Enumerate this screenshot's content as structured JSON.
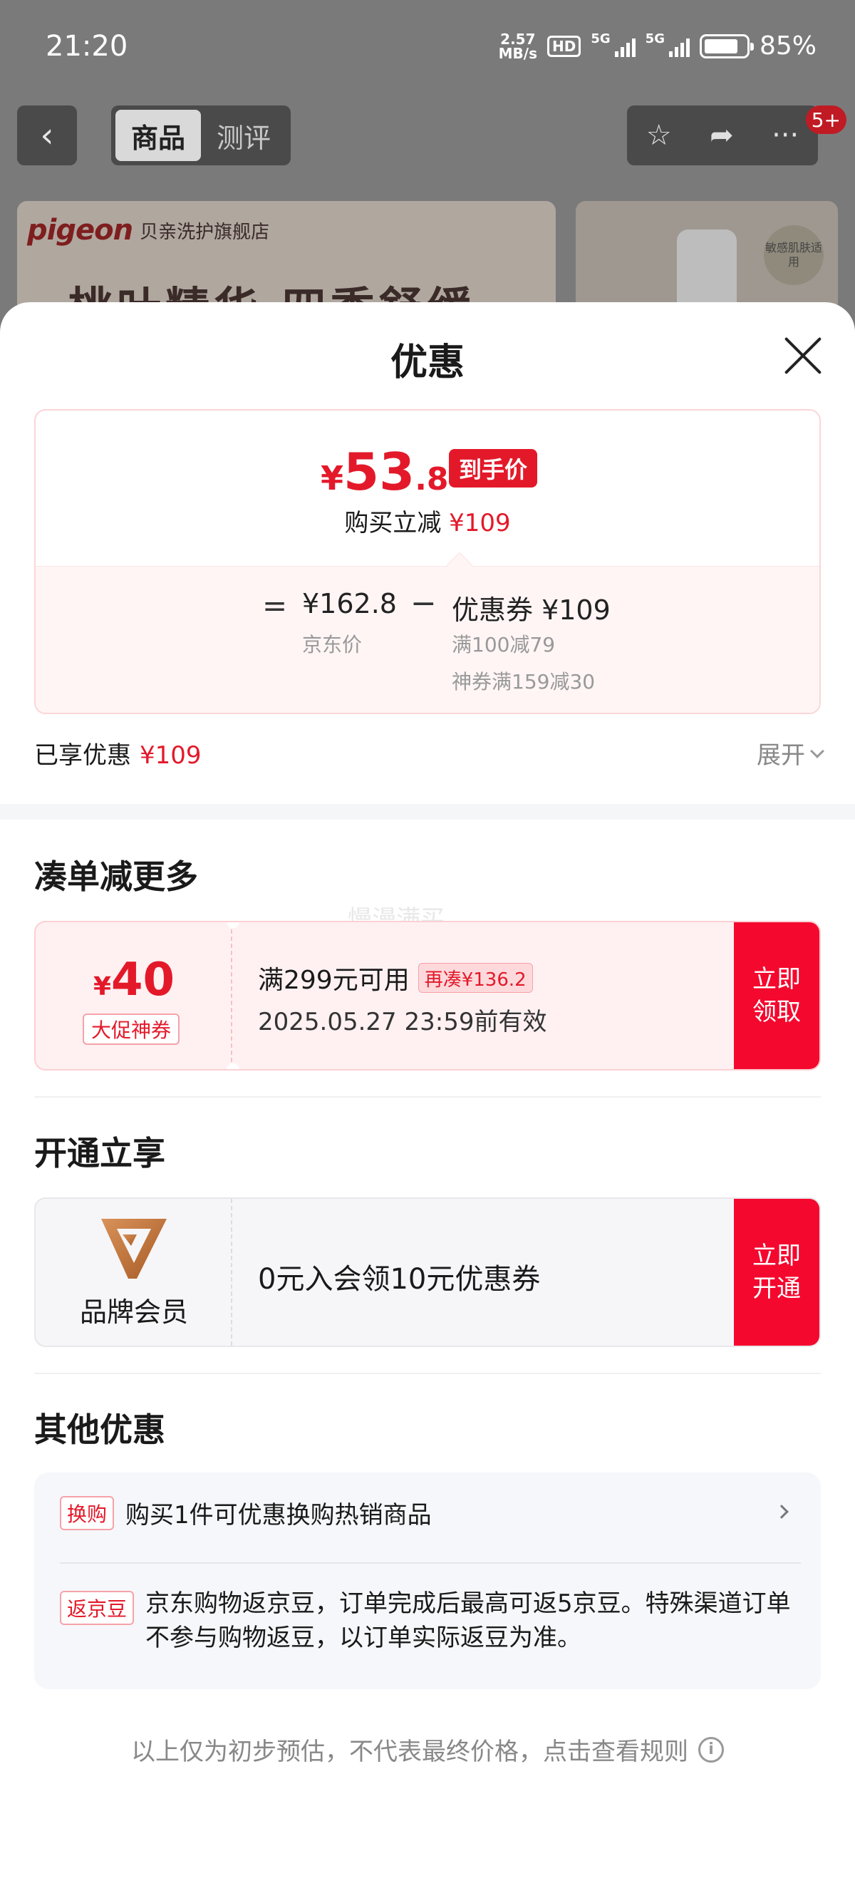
{
  "status_bar": {
    "time": "21:20",
    "net_speed_value": "2.57",
    "net_speed_unit": "MB/s",
    "hd_label": "HD",
    "sig1_label": "5G",
    "sig2_label": "5G",
    "battery": "85%"
  },
  "nav": {
    "tab_product": "商品",
    "tab_review": "测评",
    "badge_count": "5+"
  },
  "banner": {
    "logo": "pigeon",
    "store_name": "贝亲洗护旗舰店",
    "slogan": "桃叶精华 四季舒缓",
    "thumb_tag": "敏感肌肤适用"
  },
  "sheet": {
    "title": "优惠",
    "price": {
      "yen": "¥",
      "final_int": "53",
      "final_dec": ".8",
      "final_tag": "到手价",
      "instant_off_label": "购买立减",
      "instant_off_value": "¥109",
      "equals": "=",
      "jd_price": "¥162.8",
      "jd_label": "京东价",
      "minus": "−",
      "coupon_label": "优惠券 ¥109",
      "coupon_rule1": "满100减79",
      "coupon_rule2": "神券满159减30"
    },
    "enjoyed_label": "已享优惠",
    "enjoyed_value": "¥109",
    "expand_label": "展开",
    "section_more": "凑单减更多",
    "watermark": "慢漫满买",
    "coupon": {
      "yen": "¥",
      "amount": "40",
      "type": "大促神券",
      "condition": "满299元可用",
      "topup": "再凑¥136.2",
      "valid_until": "2025.05.27 23:59前有效",
      "cta": "立即领取"
    },
    "section_open": "开通立享",
    "membership": {
      "label": "品牌会员",
      "offer": "0元入会领10元优惠券",
      "cta": "立即开通"
    },
    "section_other": "其他优惠",
    "other": [
      {
        "tag": "换购",
        "text": "购买1件可优惠换购热销商品"
      },
      {
        "tag": "返京豆",
        "text": "京东购物返京豆，订单完成后最高可返5京豆。特殊渠道订单不参与购物返豆，以订单实际返豆为准。"
      }
    ],
    "footer_note": "以上仅为初步预估，不代表最终价格，点击查看规则"
  },
  "colors": {
    "accent_red": "#e3192a",
    "cta_red": "#f5082e",
    "brand_gold": "#c7773a"
  }
}
